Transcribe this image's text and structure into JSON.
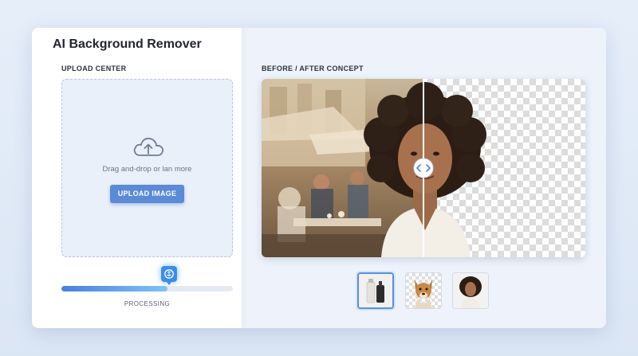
{
  "app": {
    "title": "AI Background Remover"
  },
  "upload": {
    "section_label": "UPLOAD CENTER",
    "drop_text": "Drag and-drop or lan more",
    "button_label": "UPLOAD IMAGE"
  },
  "progress": {
    "label": "PROCESSING",
    "value": 0.62
  },
  "preview": {
    "section_label": "BEFORE / AFTER CONCEPT",
    "split_position": 0.5
  },
  "thumbnails": [
    {
      "name": "product-bottles",
      "selected": true
    },
    {
      "name": "dog",
      "selected": false
    },
    {
      "name": "woman-portrait",
      "selected": false
    }
  ],
  "colors": {
    "accent": "#5b8ad6",
    "progress_start": "#4a7ee0",
    "progress_end": "#7fc3f5",
    "badge": "#3c8de8"
  }
}
